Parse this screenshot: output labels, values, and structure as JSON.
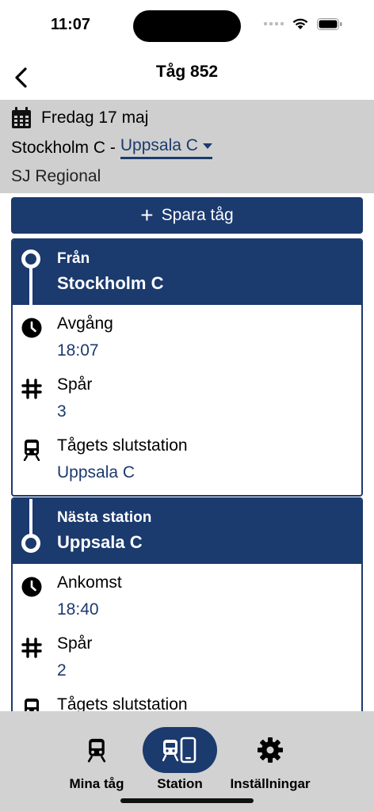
{
  "status": {
    "time": "11:07"
  },
  "nav": {
    "title": "Tåg 852"
  },
  "trip": {
    "date": "Fredag 17 maj",
    "origin": "Stockholm C -",
    "destination": "Uppsala C",
    "operator": "SJ Regional"
  },
  "save_button": {
    "label": "Spara tåg"
  },
  "stations": [
    {
      "header_label": "Från",
      "name": "Stockholm C",
      "details": [
        {
          "label": "Avgång",
          "value": "18:07",
          "icon": "clock-icon"
        },
        {
          "label": "Spår",
          "value": "3",
          "icon": "track-icon"
        },
        {
          "label": "Tågets slutstation",
          "value": "Uppsala C",
          "icon": "train-icon"
        }
      ]
    },
    {
      "header_label": "Nästa station",
      "name": "Uppsala C",
      "details": [
        {
          "label": "Ankomst",
          "value": "18:40",
          "icon": "clock-icon"
        },
        {
          "label": "Spår",
          "value": "2",
          "icon": "track-icon"
        },
        {
          "label": "Tågets slutstation",
          "value": "",
          "icon": "train-icon"
        }
      ]
    }
  ],
  "tabs": [
    {
      "label": "Mina tåg",
      "icon": "train-icon",
      "active": false
    },
    {
      "label": "Station",
      "icon": "station-icon",
      "active": true
    },
    {
      "label": "Inställningar",
      "icon": "gear-icon",
      "active": false
    }
  ],
  "colors": {
    "primary": "#1b3a6e",
    "band": "#cfcfcf",
    "tabbar": "#d2d2d2"
  }
}
